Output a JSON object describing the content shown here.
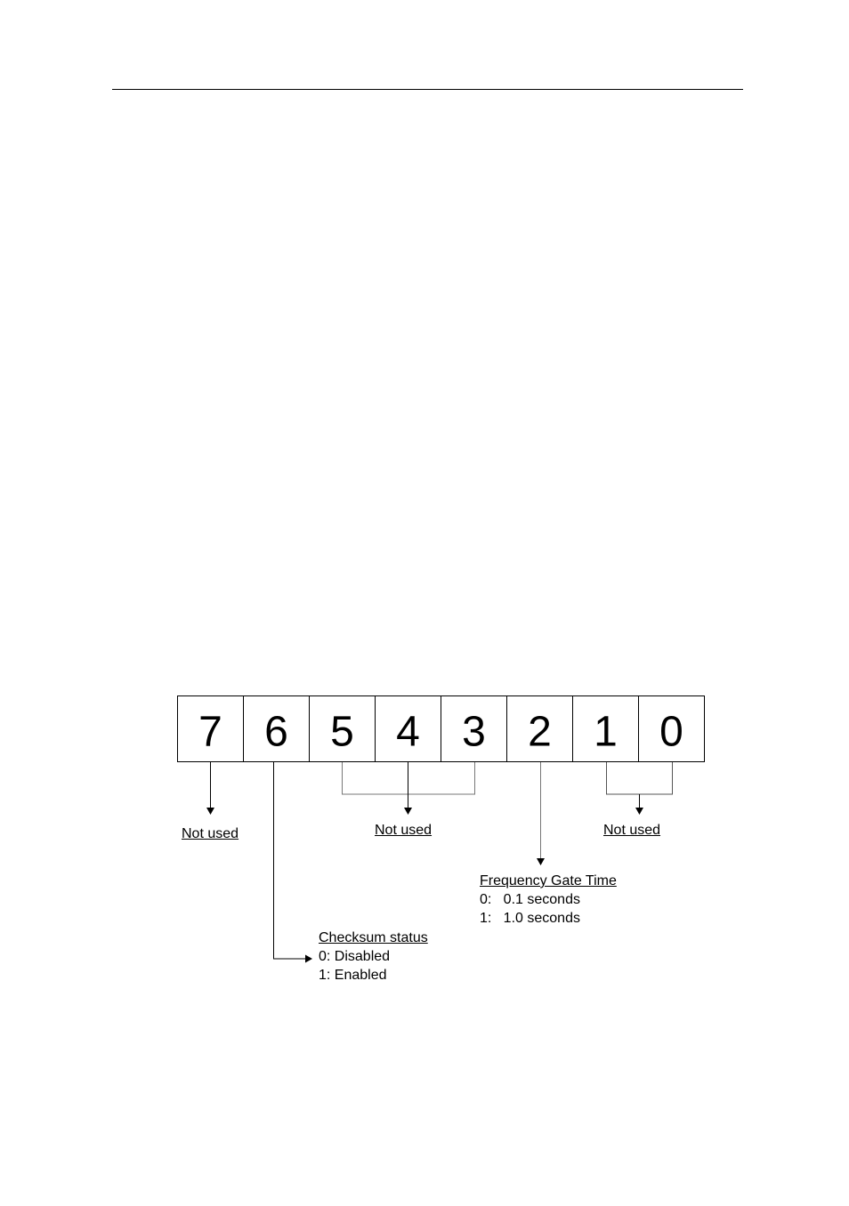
{
  "register": {
    "bits": [
      "7",
      "6",
      "5",
      "4",
      "3",
      "2",
      "1",
      "0"
    ]
  },
  "annotations": {
    "bit7": {
      "title": "Not used"
    },
    "bits5to3": {
      "title": "Not used"
    },
    "bits1to0": {
      "title": "Not used"
    },
    "bit2": {
      "title": "Frequency Gate Time",
      "line0": "0:   0.1 seconds",
      "line1": "1:   1.0 seconds"
    },
    "bit6": {
      "title": "Checksum status",
      "line0": "0: Disabled",
      "line1": "1: Enabled"
    }
  }
}
